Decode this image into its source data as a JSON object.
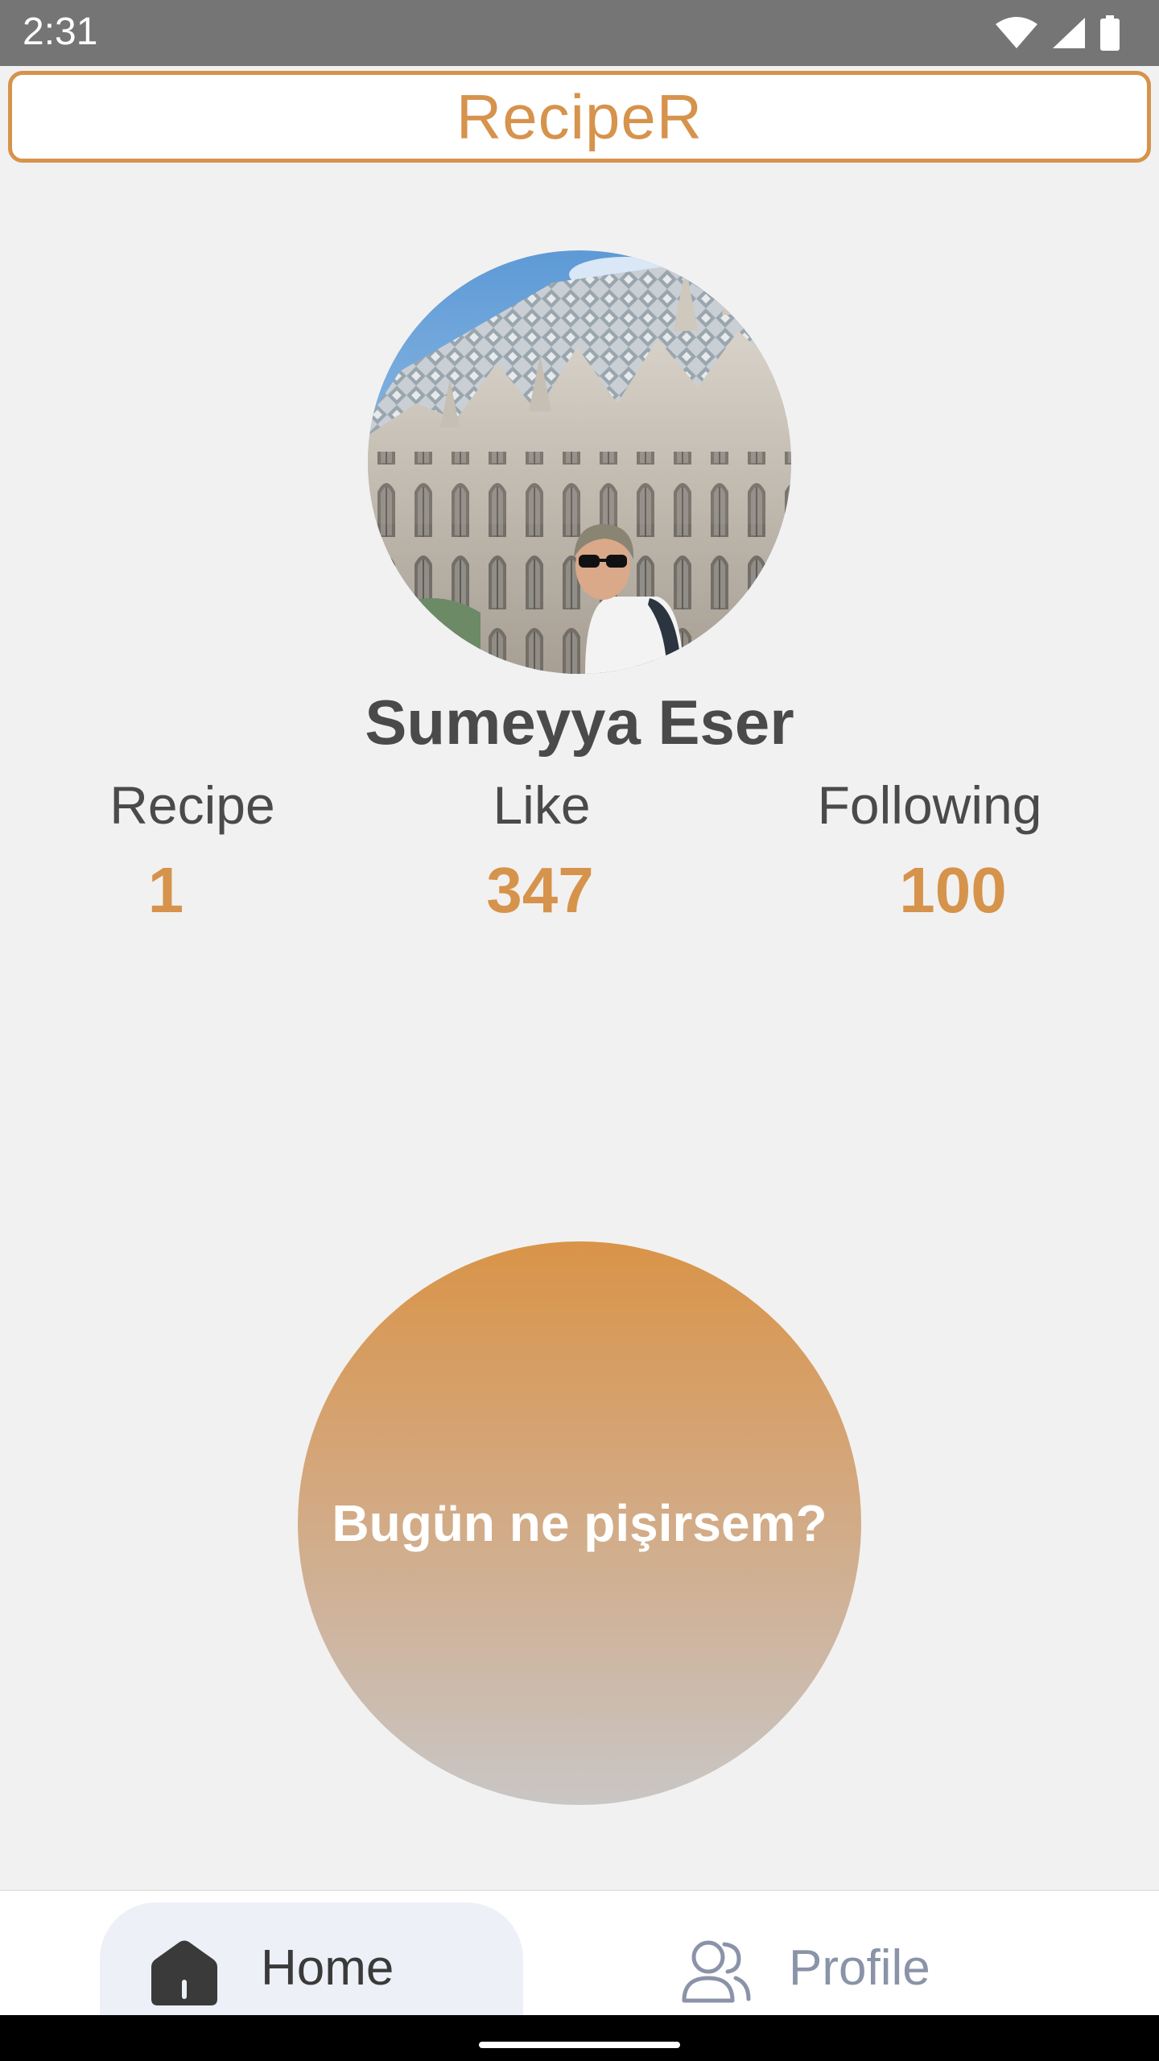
{
  "status_bar": {
    "time": "2:31",
    "icons": [
      "wifi-icon",
      "signal-icon",
      "battery-icon"
    ]
  },
  "app_bar": {
    "title": "RecipeR"
  },
  "profile": {
    "name": "Sumeyya Eser",
    "avatar": "profile-photo",
    "stats": [
      {
        "label": "Recipe",
        "value": "1"
      },
      {
        "label": "Like",
        "value": "347"
      },
      {
        "label": "Following",
        "value": "100"
      }
    ]
  },
  "action": {
    "label": "Bugün ne pişirsem?"
  },
  "bottom_nav": {
    "items": [
      {
        "label": "Home",
        "icon": "home-icon",
        "selected": true
      },
      {
        "label": "Profile",
        "icon": "users-icon",
        "selected": false
      }
    ]
  },
  "colors": {
    "accent": "#d6934c",
    "background": "#f2f1f1",
    "text": "#4a4a4a",
    "nav_inactive": "#8a93a8"
  }
}
